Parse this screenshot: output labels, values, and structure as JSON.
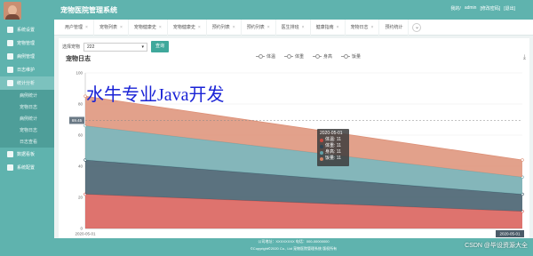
{
  "header": {
    "app_title": "宠物医院管理系统",
    "links": [
      "我的/",
      "admin",
      "[修改密码]",
      "[退出]"
    ]
  },
  "sidebar": {
    "items": [
      {
        "label": "系统设置"
      },
      {
        "label": "宠物管理"
      },
      {
        "label": "病例管理"
      },
      {
        "label": "日志维护"
      },
      {
        "label": "统计分析",
        "active": true
      }
    ],
    "sub_items": [
      "病例统计",
      "宠物日志",
      "病例统计",
      "宠物日志",
      "日志查看"
    ],
    "tail_items": [
      {
        "label": "数据看板"
      },
      {
        "label": "系统配置"
      }
    ]
  },
  "tabs": [
    "用户管理",
    "宠物列表",
    "宠物健康史",
    "宠物健康史",
    "预约列表",
    "预约列表",
    "医生排班",
    "健康指南",
    "宠物日志",
    "预约统计"
  ],
  "filter": {
    "label": "选择宠物",
    "selected": "222",
    "query_button": "查询"
  },
  "chart_title": "宠物日志",
  "watermark": "水牛专业Java开发",
  "tooltip": {
    "date": "2020-05-01",
    "rows": [
      {
        "label": "体温: 11",
        "color": "#c9473e"
      },
      {
        "label": "体重: 11",
        "color": "#2f4554"
      },
      {
        "label": "身高: 11",
        "color": "#61a0a8"
      },
      {
        "label": "饭量: 11",
        "color": "#d48265"
      }
    ]
  },
  "chart_data": {
    "type": "area",
    "stacked": true,
    "x": [
      "2020-05-01",
      "2020-05-01"
    ],
    "ylim": [
      0,
      100
    ],
    "yticks": [
      0,
      20,
      40,
      60,
      80,
      100
    ],
    "y_pointer_label": "69.45",
    "series": [
      {
        "name": "体温",
        "values": [
          22,
          11
        ],
        "color": "#d85b55"
      },
      {
        "name": "体重",
        "values": [
          22,
          11
        ],
        "color": "#3e5968"
      },
      {
        "name": "身高",
        "values": [
          22,
          11
        ],
        "color": "#6fa9ae"
      },
      {
        "name": "饭量",
        "values": [
          19,
          11
        ],
        "color": "#dd9077"
      }
    ],
    "legend": "top-center",
    "grid": true
  },
  "footer": {
    "line1": "公司地址：XXXXXXXX 电话：000-00000000",
    "line2": "©Copyright©2020 Co., Ltd 宠物医院管理系统 版权所有"
  },
  "csdn_watermark": "CSDN @毕设资源大全"
}
